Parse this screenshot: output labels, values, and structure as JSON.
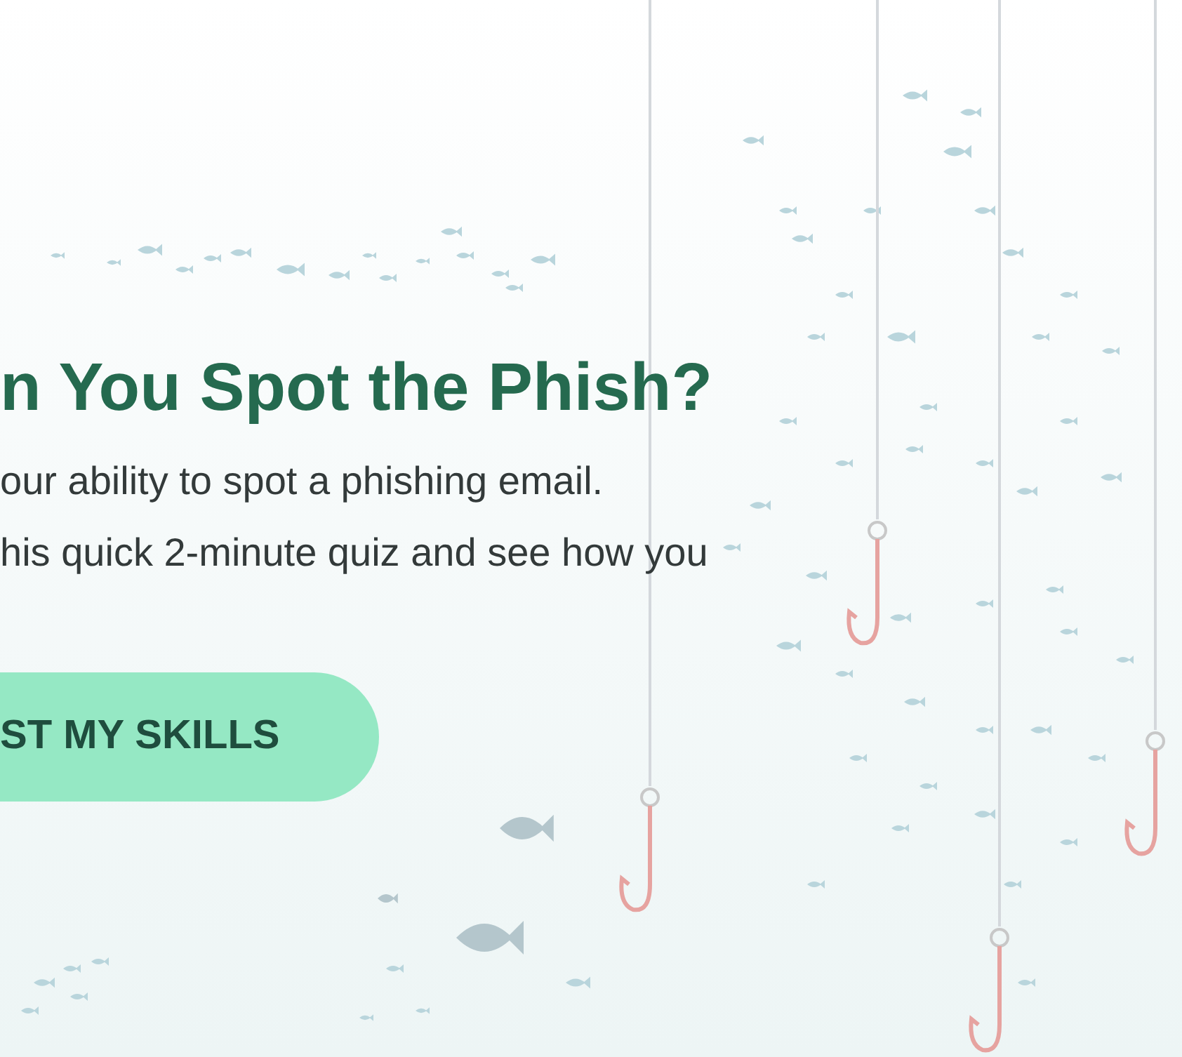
{
  "hero": {
    "title": "n You Spot the Phish?",
    "description_lines": [
      "our ability to spot a phishing email.",
      "his quick 2-minute quiz and see how you"
    ],
    "cta_button": "ST MY SKILLS"
  }
}
